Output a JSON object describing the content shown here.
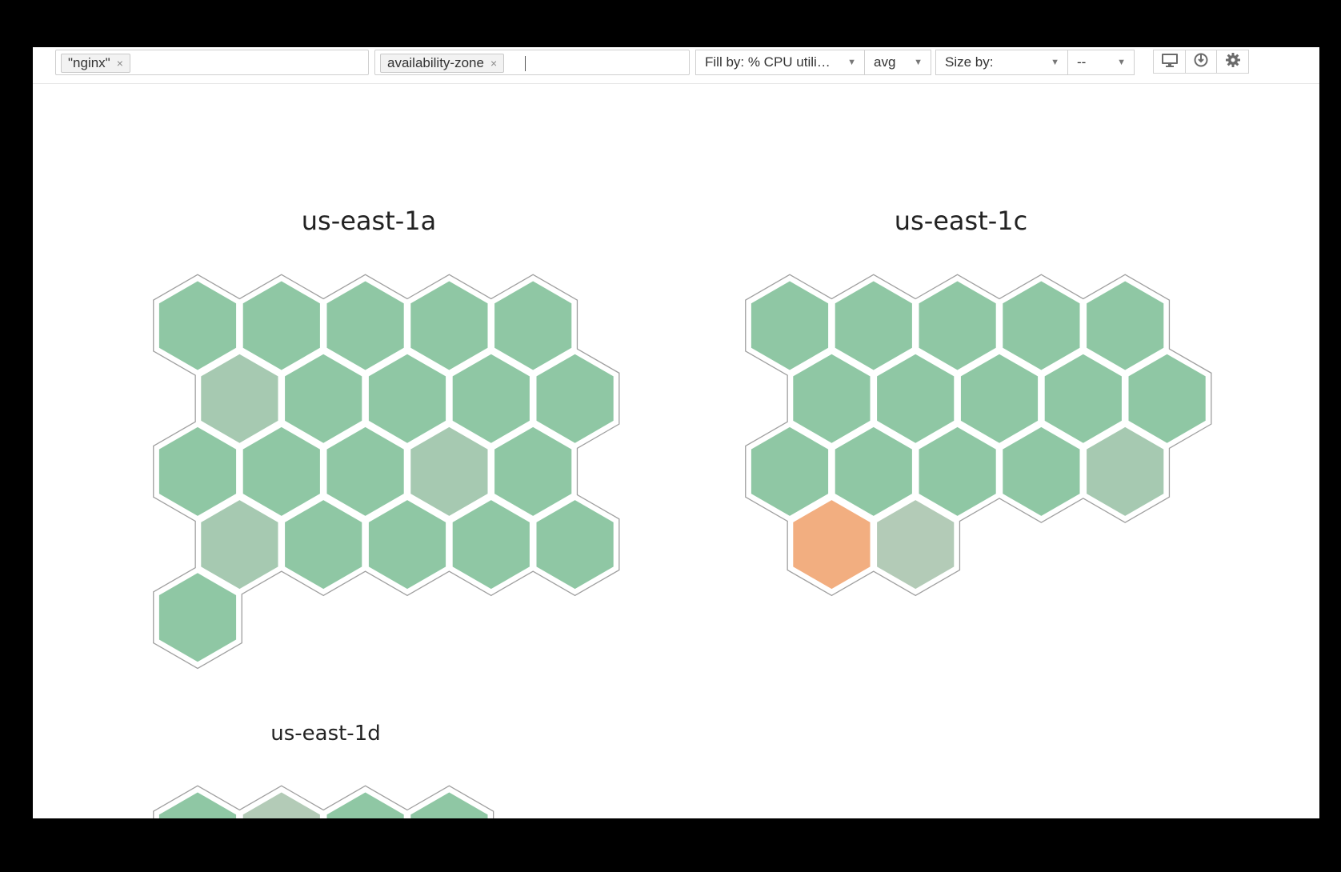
{
  "filters": {
    "filter_tags": [
      {
        "label": "\"nginx\""
      }
    ],
    "group_tags": [
      {
        "label": "availability-zone"
      }
    ],
    "remove_glyph": "×"
  },
  "fill": {
    "label": "Fill by: % CPU utili…",
    "aggregation": "avg"
  },
  "size": {
    "label": "Size by:",
    "aggregation": "--"
  },
  "toolbar_icons": [
    "monitor-icon",
    "power-icon",
    "gear-icon"
  ],
  "colors": {
    "green": "#8fc7a4",
    "muted_green": "#a6c9b1",
    "gray_green": "#b3cbb7",
    "orange": "#f2ae80",
    "outline": "#9f9f9f"
  },
  "zones": [
    {
      "name": "us-east-1a",
      "rows": [
        [
          "green",
          "green",
          "green",
          "green",
          "green"
        ],
        [
          "muted_green",
          "green",
          "green",
          "green",
          "green"
        ],
        [
          "green",
          "green",
          "green",
          "muted_green",
          "green"
        ],
        [
          "muted_green",
          "green",
          "green",
          "green",
          "green"
        ],
        [
          "green"
        ]
      ]
    },
    {
      "name": "us-east-1c",
      "rows": [
        [
          "green",
          "green",
          "green",
          "green",
          "green"
        ],
        [
          "green",
          "green",
          "green",
          "green",
          "green"
        ],
        [
          "green",
          "green",
          "green",
          "green",
          "muted_green"
        ],
        [
          "orange",
          "gray_green"
        ]
      ]
    },
    {
      "name": "us-east-1d",
      "rows": [
        [
          "green",
          "gray_green",
          "green",
          "green"
        ]
      ]
    }
  ]
}
